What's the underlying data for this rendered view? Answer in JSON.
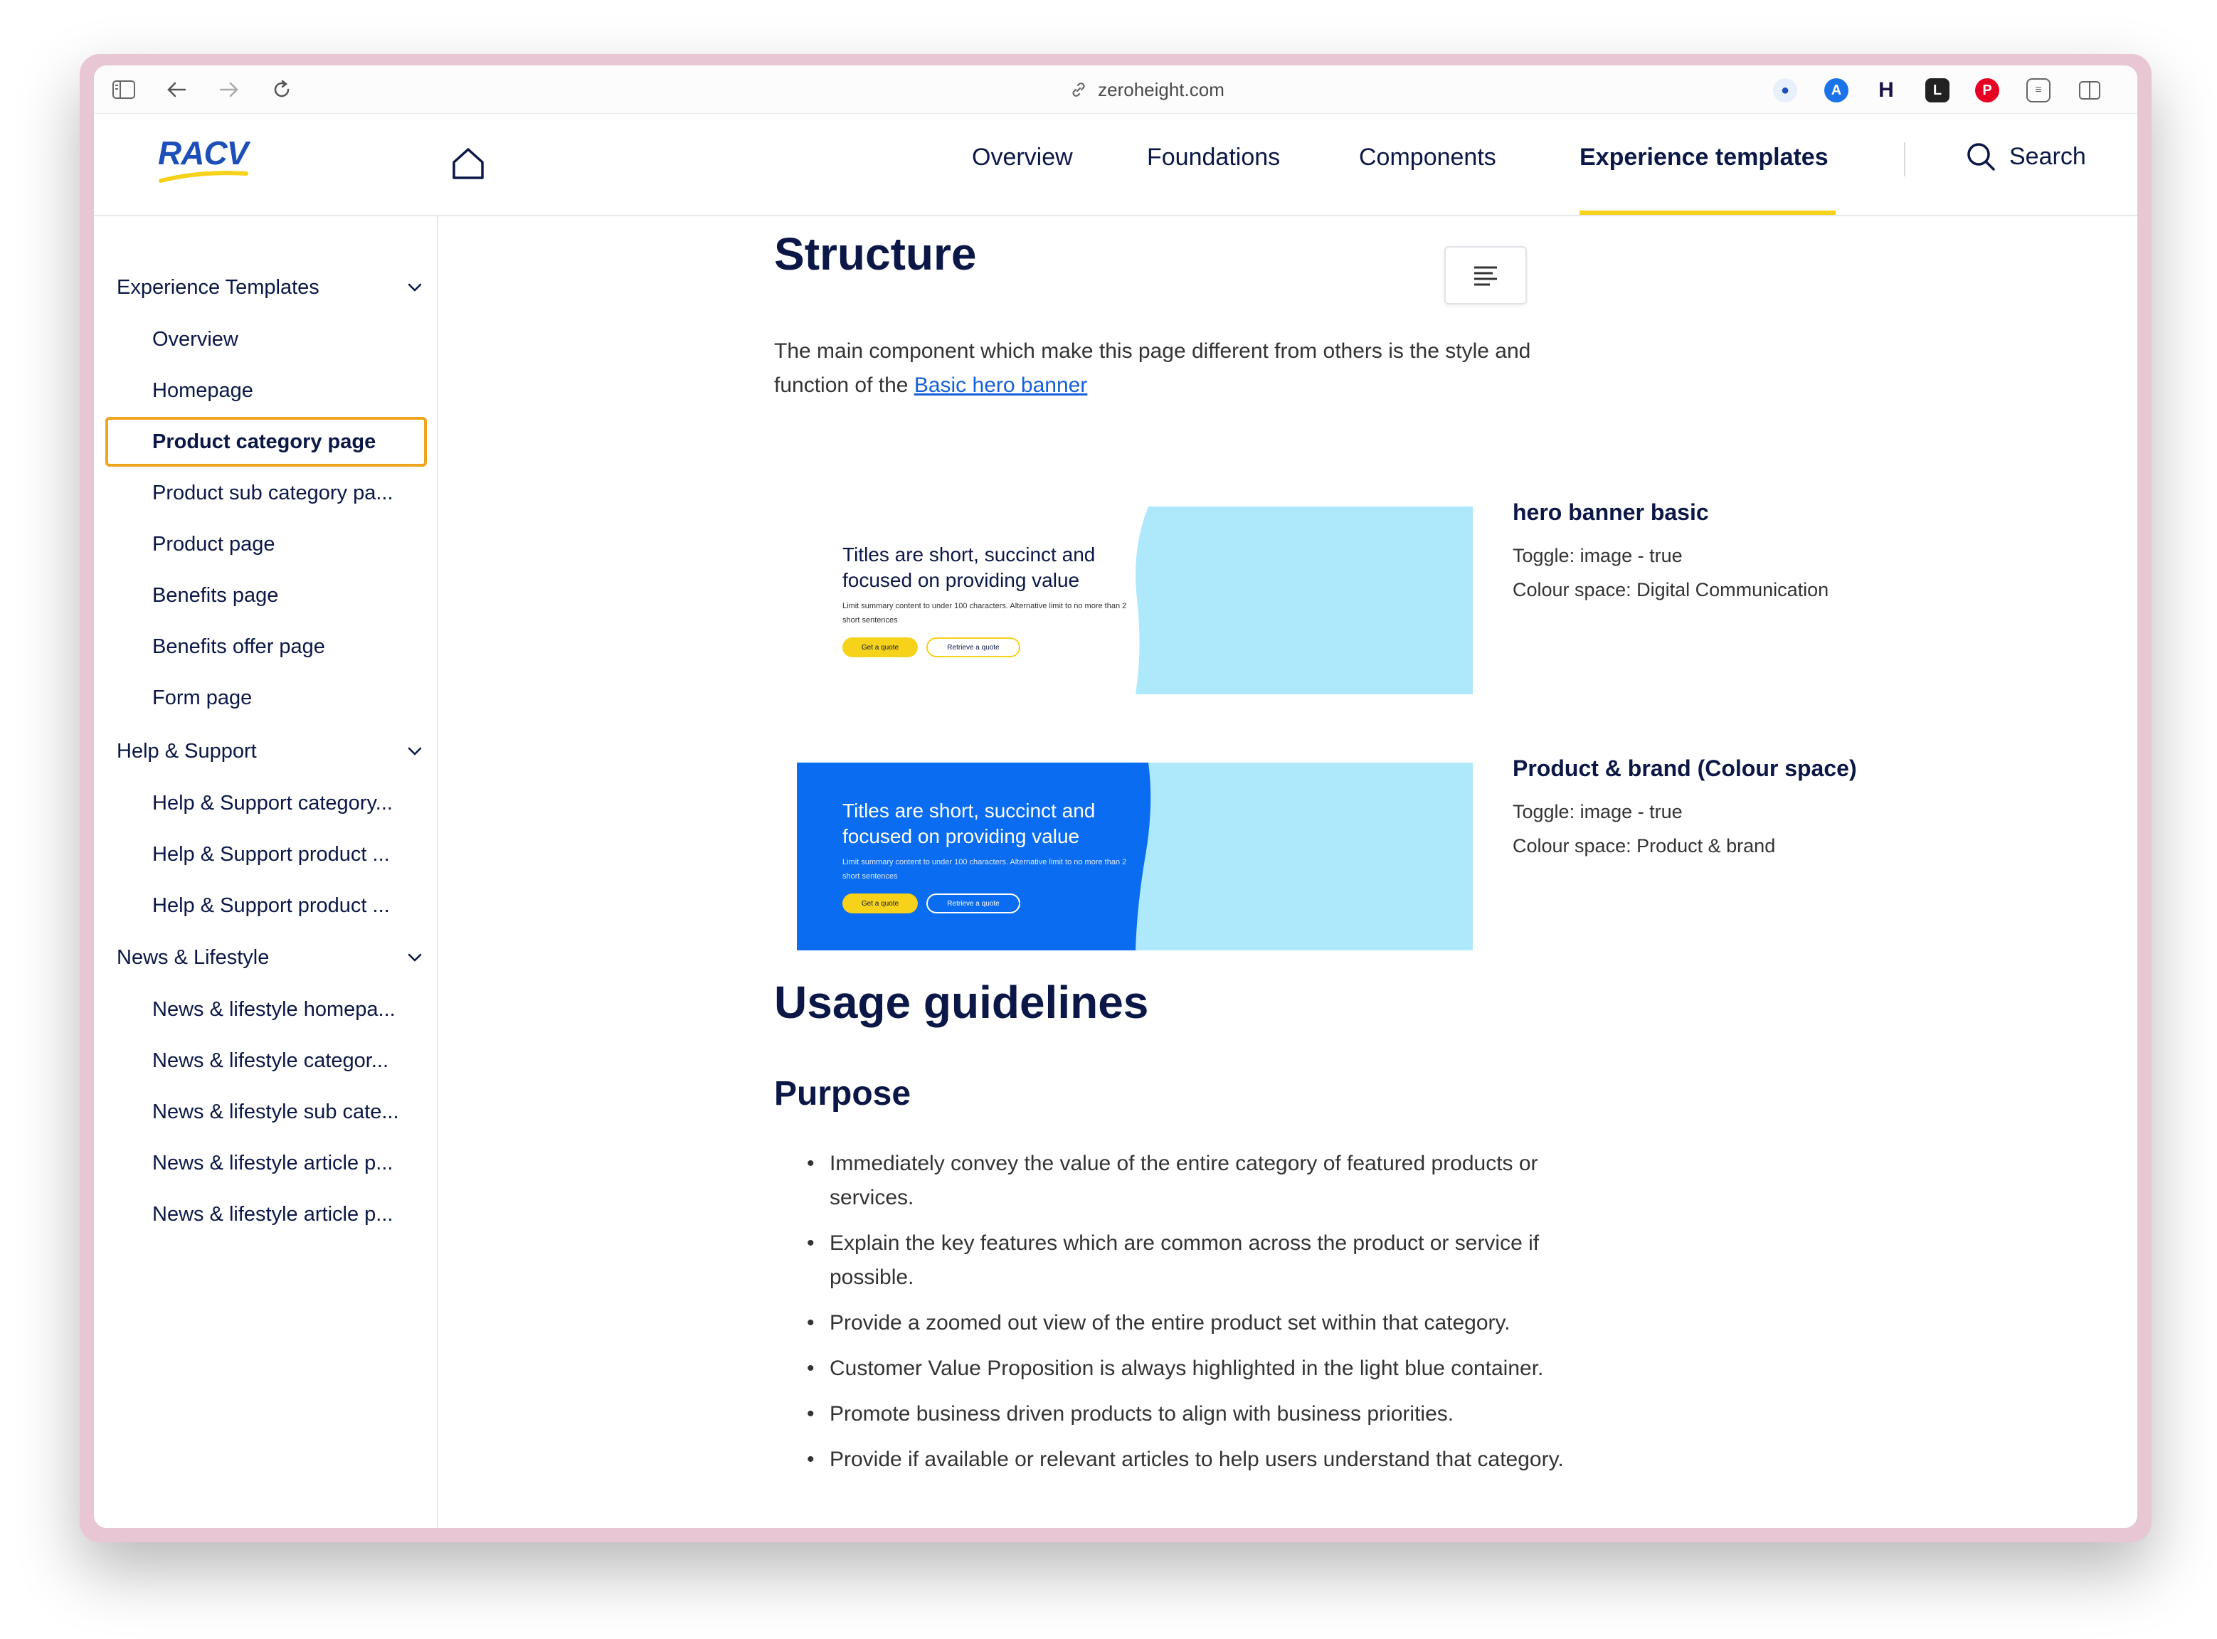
{
  "browser": {
    "url": "zeroheight.com"
  },
  "header": {
    "logo_text": "RACV",
    "nav": [
      {
        "label": "Overview"
      },
      {
        "label": "Foundations"
      },
      {
        "label": "Components"
      },
      {
        "label": "Experience templates"
      }
    ],
    "active_nav": "Experience templates",
    "search_label": "Search",
    "accent_color": "#f7d21a"
  },
  "sidebar": {
    "groups": [
      {
        "label": "Experience Templates",
        "items": [
          "Overview",
          "Homepage",
          "Product category page",
          "Product sub category pa...",
          "Product page",
          "Benefits page",
          "Benefits offer page",
          "Form page"
        ]
      },
      {
        "label": "Help & Support",
        "items": [
          "Help & Support category...",
          "Help & Support product ...",
          "Help & Support product ..."
        ]
      },
      {
        "label": "News & Lifestyle",
        "items": [
          "News & lifestyle homepa...",
          "News & lifestyle categor...",
          "News & lifestyle sub cate...",
          "News & lifestyle article p...",
          "News & lifestyle article p..."
        ]
      }
    ],
    "selected_item": "Product category page"
  },
  "main": {
    "structure_heading": "Structure",
    "intro_text": "The main component which make this page different from others is the style and function of the",
    "intro_link": "Basic hero banner",
    "banners": [
      {
        "title": "Titles are short, succinct and focused on providing value",
        "summary": "Limit summary content to under 100 characters. Alternative limit to no more than 2 short sentences",
        "primary_button": "Get a quote",
        "secondary_button": "Retrieve a quote",
        "card_title": "hero banner basic",
        "toggle": "Toggle: image - true",
        "colour_space": "Colour space: Digital Communication",
        "left_color": "#ffffff",
        "right_color": "#aee8fb"
      },
      {
        "title": "Titles are short, succinct and focused on providing value",
        "summary": "Limit summary content to under 100 characters. Alternative limit to no more than 2 short sentences",
        "primary_button": "Get a quote",
        "secondary_button": "Retrieve a quote",
        "card_title": "Product & brand (Colour space)",
        "toggle": "Toggle: image - true",
        "colour_space": "Colour space: Product & brand",
        "left_color": "#0a6cf0",
        "right_color": "#aee8fb"
      }
    ],
    "usage_heading": "Usage guidelines",
    "purpose_heading": "Purpose",
    "purpose_bullets": [
      "Immediately convey the value of the entire category of featured products or services.",
      "Explain the key features which are common across the product or service if possible.",
      "Provide a zoomed out view of the entire product set within that category.",
      "Customer Value Proposition is always highlighted in the light blue container.",
      "Promote business driven products to align with business priorities.",
      "Provide if available or relevant articles to help users understand that category."
    ]
  }
}
